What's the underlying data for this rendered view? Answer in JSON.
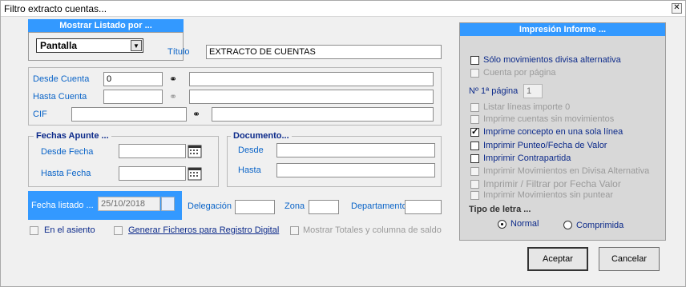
{
  "window": {
    "title": "Filtro extracto cuentas..."
  },
  "mostrar": {
    "header": "Mostrar Listado por ...",
    "selected": "Pantalla"
  },
  "titulo": {
    "label": "Título",
    "value": "EXTRACTO DE CUENTAS"
  },
  "cuentas": {
    "desde_label": "Desde Cuenta",
    "desde_value": "0",
    "hasta_label": "Hasta Cuenta",
    "cif_label": "CIF"
  },
  "fechas": {
    "title": "Fechas Apunte ...",
    "desde_label": "Desde Fecha",
    "hasta_label": "Hasta Fecha"
  },
  "documento": {
    "title": "Documento...",
    "desde_label": "Desde",
    "hasta_label": "Hasta"
  },
  "listado": {
    "label": "Fecha listado ...",
    "value": "25/10/2018",
    "delegacion_label": "Delegación",
    "zona_label": "Zona",
    "departamento_label": "Departamento"
  },
  "bottom_options": [
    {
      "label": "En el asiento"
    },
    {
      "label": "Generar Ficheros para Registro Digital"
    },
    {
      "label": "Mostrar Totales y columna de saldo"
    }
  ],
  "impresion": {
    "header": "Impresión Informe ...",
    "options": [
      {
        "label": "Sólo movimientos divisa alternativa",
        "checked": false,
        "enabled": true
      },
      {
        "label": "Cuenta por página",
        "checked": false,
        "enabled": false
      }
    ],
    "pagina_label": "Nº 1ª página",
    "pagina_value": "1",
    "options2": [
      {
        "label": "Listar líneas importe 0",
        "checked": false,
        "enabled": false
      },
      {
        "label": "Imprime cuentas sin movimientos",
        "checked": false,
        "enabled": false
      },
      {
        "label": "Imprime concepto en una sola línea",
        "checked": true,
        "enabled": true
      },
      {
        "label": "Imprimir Punteo/Fecha de Valor",
        "checked": false,
        "enabled": true
      },
      {
        "label": "Imprimir Contrapartida",
        "checked": false,
        "enabled": true
      },
      {
        "label": "Imprimir Movimientos en Divisa Alternativa",
        "checked": false,
        "enabled": false
      },
      {
        "label": "Imprimir / Filtrar por Fecha Valor",
        "checked": false,
        "enabled": false
      },
      {
        "label": "Imprimir Movimientos sin puntear",
        "checked": false,
        "enabled": false
      }
    ],
    "tipo_letra_label": "Tipo de letra ...",
    "normal_label": "Normal",
    "comprimida_label": "Comprimida"
  },
  "buttons": {
    "aceptar": "Aceptar",
    "cancelar": "Cancelar"
  },
  "colors": {
    "accent": "#3399ff",
    "label_blue": "#0a64c8",
    "navy": "#0c2a8a"
  }
}
